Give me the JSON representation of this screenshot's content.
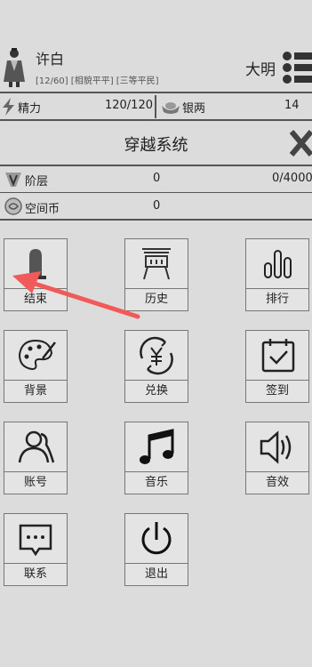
{
  "player": {
    "name": "许白",
    "tags": "[12/60] [相貌平平] [三等平民]",
    "dynasty": "大明"
  },
  "resources": [
    {
      "label": "精力",
      "value": "120/120",
      "icon": "energy-icon"
    },
    {
      "label": "银两",
      "value": "14",
      "icon": "silver-ingot-icon"
    }
  ],
  "system": {
    "title": "穿越系统",
    "close_icon": "close-icon"
  },
  "stats": [
    {
      "label": "阶层",
      "value": "0",
      "max": "0/4000",
      "icon": "rank-v-icon"
    },
    {
      "label": "空间币",
      "value": "0",
      "icon": "space-coin-icon"
    }
  ],
  "grid": [
    {
      "label": "结束",
      "icon": "tombstone-icon"
    },
    {
      "label": "历史",
      "icon": "history-board-icon"
    },
    {
      "label": "排行",
      "icon": "ranking-bars-icon"
    },
    {
      "label": "背景",
      "icon": "palette-icon"
    },
    {
      "label": "兑换",
      "icon": "exchange-icon"
    },
    {
      "label": "签到",
      "icon": "calendar-check-icon"
    },
    {
      "label": "账号",
      "icon": "account-icon"
    },
    {
      "label": "音乐",
      "icon": "music-note-icon"
    },
    {
      "label": "音效",
      "icon": "speaker-icon"
    },
    {
      "label": "联系",
      "icon": "chat-icon"
    },
    {
      "label": "退出",
      "icon": "power-icon"
    }
  ],
  "colors": {
    "background": "#dcdcdc",
    "line": "#555555",
    "arrow": "#f25a5a"
  }
}
